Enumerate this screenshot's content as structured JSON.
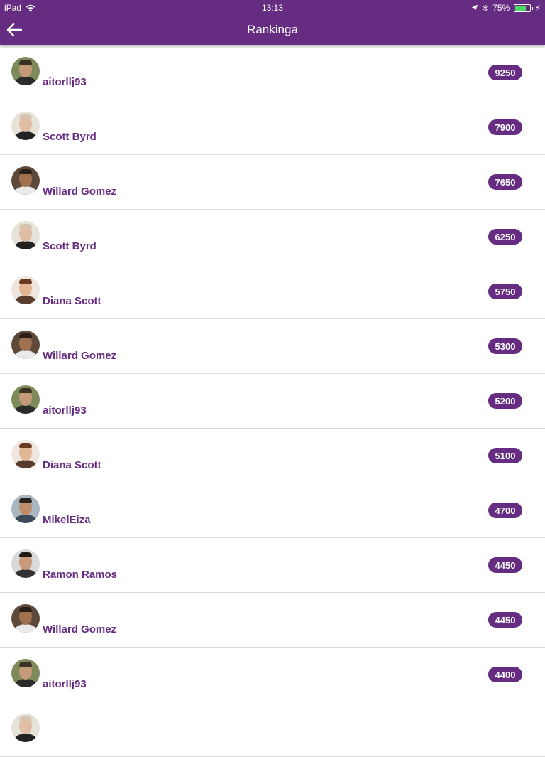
{
  "status": {
    "device": "iPad",
    "time": "13:13",
    "battery": "75%",
    "battery_level": 0.75
  },
  "nav": {
    "title": "Rankinga",
    "back_icon": "arrow-left-icon"
  },
  "colors": {
    "primary": "#662c82",
    "battery_green": "#4cd964"
  },
  "rankings": [
    {
      "name": "aitorllj93",
      "score": "9250",
      "avatar": "a"
    },
    {
      "name": "Scott Byrd",
      "score": "7900",
      "avatar": "s"
    },
    {
      "name": "Willard Gomez",
      "score": "7650",
      "avatar": "w"
    },
    {
      "name": "Scott Byrd",
      "score": "6250",
      "avatar": "s"
    },
    {
      "name": "Diana Scott",
      "score": "5750",
      "avatar": "d"
    },
    {
      "name": "Willard Gomez",
      "score": "5300",
      "avatar": "w"
    },
    {
      "name": "aitorllj93",
      "score": "5200",
      "avatar": "a"
    },
    {
      "name": "Diana Scott",
      "score": "5100",
      "avatar": "d"
    },
    {
      "name": "MikelEiza",
      "score": "4700",
      "avatar": "m"
    },
    {
      "name": "Ramon Ramos",
      "score": "4450",
      "avatar": "r"
    },
    {
      "name": "Willard Gomez",
      "score": "4450",
      "avatar": "w"
    },
    {
      "name": "aitorllj93",
      "score": "4400",
      "avatar": "a"
    },
    {
      "name": "",
      "score": "",
      "avatar": "s"
    }
  ]
}
